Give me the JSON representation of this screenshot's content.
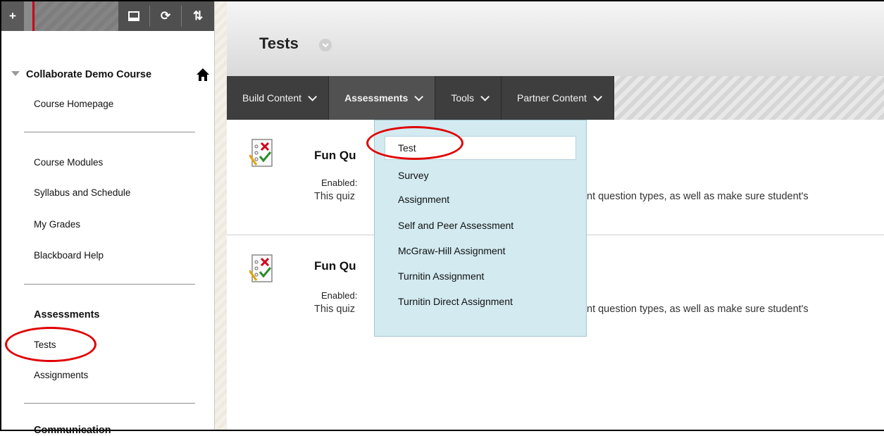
{
  "toolbar": {
    "add_label": "+",
    "refresh_symbol": "⟳",
    "sort_symbol": "⇅"
  },
  "course": {
    "title": "Collaborate Demo Course",
    "nav_group1": [
      "Course Homepage"
    ],
    "nav_group2": [
      "Course Modules",
      "Syllabus and Schedule",
      "My Grades",
      "Blackboard Help"
    ],
    "assessments_heading": "Assessments",
    "assessments_items": [
      "Tests",
      "Assignments"
    ],
    "communication_heading": "Communication"
  },
  "page": {
    "title": "Tests"
  },
  "action_bar": {
    "tabs": [
      "Build Content",
      "Assessments",
      "Tools",
      "Partner Content"
    ]
  },
  "items": [
    {
      "title": "Fun Qu",
      "enabled": "Enabled:",
      "desc_left": "This quiz",
      "desc_right": "nt question types, as well as make sure student's"
    },
    {
      "title": "Fun Qu",
      "enabled": "Enabled:",
      "desc_left": "This quiz",
      "desc_right": "nt question types, as well as make sure student's"
    }
  ],
  "dropdown": {
    "items": [
      "Test",
      "Survey",
      "Assignment",
      "Self and Peer Assessment",
      "McGraw-Hill Assignment",
      "Turnitin Assignment",
      "Turnitin Direct Assignment"
    ]
  },
  "colors": {
    "highlight_ring": "#e00000",
    "dropdown_bg": "#d2eaf0",
    "action_bar_bg": "#3e3e3e"
  }
}
